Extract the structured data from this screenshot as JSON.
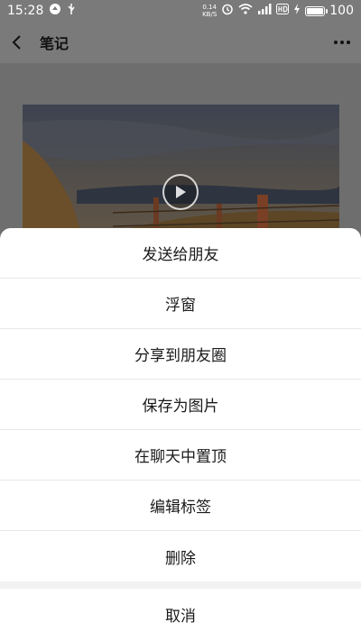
{
  "status": {
    "time": "15:28",
    "speed_value": "0.14",
    "speed_unit": "KB/S",
    "battery_text": "100",
    "battery_level": 1.0
  },
  "nav": {
    "title": "笔记"
  },
  "sheet": {
    "items": [
      "发送给朋友",
      "浮窗",
      "分享到朋友圈",
      "保存为图片",
      "在聊天中置顶",
      "编辑标签",
      "删除"
    ],
    "cancel": "取消"
  }
}
